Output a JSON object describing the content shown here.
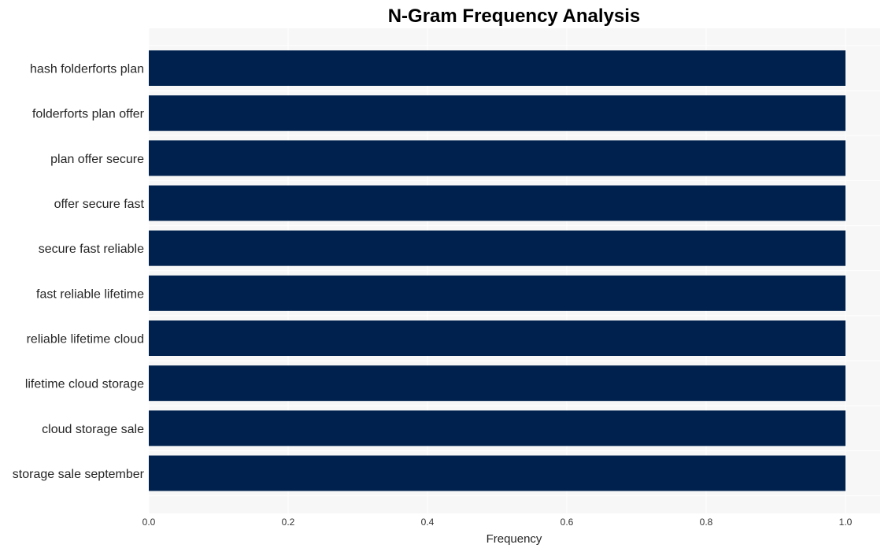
{
  "chart_data": {
    "type": "bar",
    "orientation": "horizontal",
    "title": "N-Gram Frequency Analysis",
    "xlabel": "Frequency",
    "ylabel": "",
    "categories": [
      "hash folderforts plan",
      "folderforts plan offer",
      "plan offer secure",
      "offer secure fast",
      "secure fast reliable",
      "fast reliable lifetime",
      "reliable lifetime cloud",
      "lifetime cloud storage",
      "cloud storage sale",
      "storage sale september"
    ],
    "values": [
      1,
      1,
      1,
      1,
      1,
      1,
      1,
      1,
      1,
      1
    ],
    "xlim": [
      0,
      1.05
    ],
    "xticks": [
      "0.0",
      "0.2",
      "0.4",
      "0.6",
      "0.8",
      "1.0"
    ],
    "grid": true,
    "bar_color": "#00214d",
    "background_color": "#f7f7f7"
  }
}
